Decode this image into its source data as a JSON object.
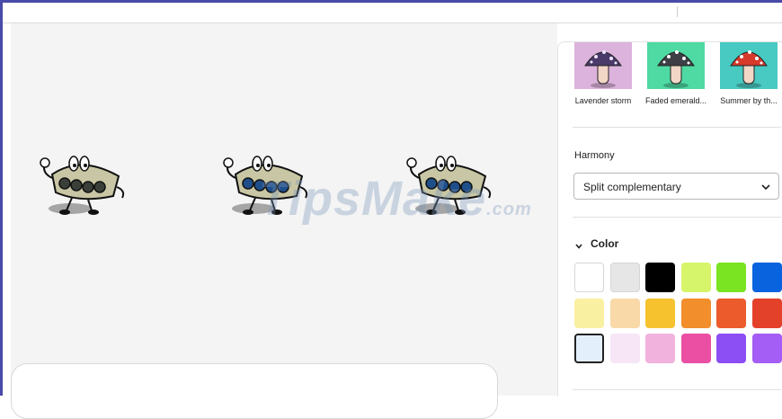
{
  "presets": [
    {
      "label": "Lavender storm",
      "bg": "#dcb3dc",
      "cap": "#4a3b6b",
      "dots": "#f0e6ff"
    },
    {
      "label": "Faded emerald...",
      "bg": "#4fd9a3",
      "cap": "#3e3e46",
      "dots": "#ffffff"
    },
    {
      "label": "Summer by th...",
      "bg": "#48c9c1",
      "cap": "#d73a2a",
      "dots": "#ffffff"
    }
  ],
  "harmony": {
    "title": "Harmony",
    "selected": "Split complementary"
  },
  "color": {
    "title": "Color",
    "swatches": [
      [
        "#ffffff",
        "#e6e6e6",
        "#000000",
        "#d7f56a",
        "#7ae322",
        "#0a63de"
      ],
      [
        "#faf0a2",
        "#f9d9a8",
        "#f6c32f",
        "#f28e2c",
        "#ec5b2c",
        "#e4412b"
      ],
      [
        "#e3effa",
        "#f6e6f6",
        "#f2b2de",
        "#ea4fa3",
        "#8c4ff4",
        "#a45ef6"
      ]
    ],
    "selected": [
      2,
      0
    ]
  },
  "watermark": {
    "main": "TipsMake",
    "suffix": ".com"
  },
  "mascot_colors": [
    "#3a3f3a",
    "#1f4f8a",
    "#1f4f8a"
  ]
}
